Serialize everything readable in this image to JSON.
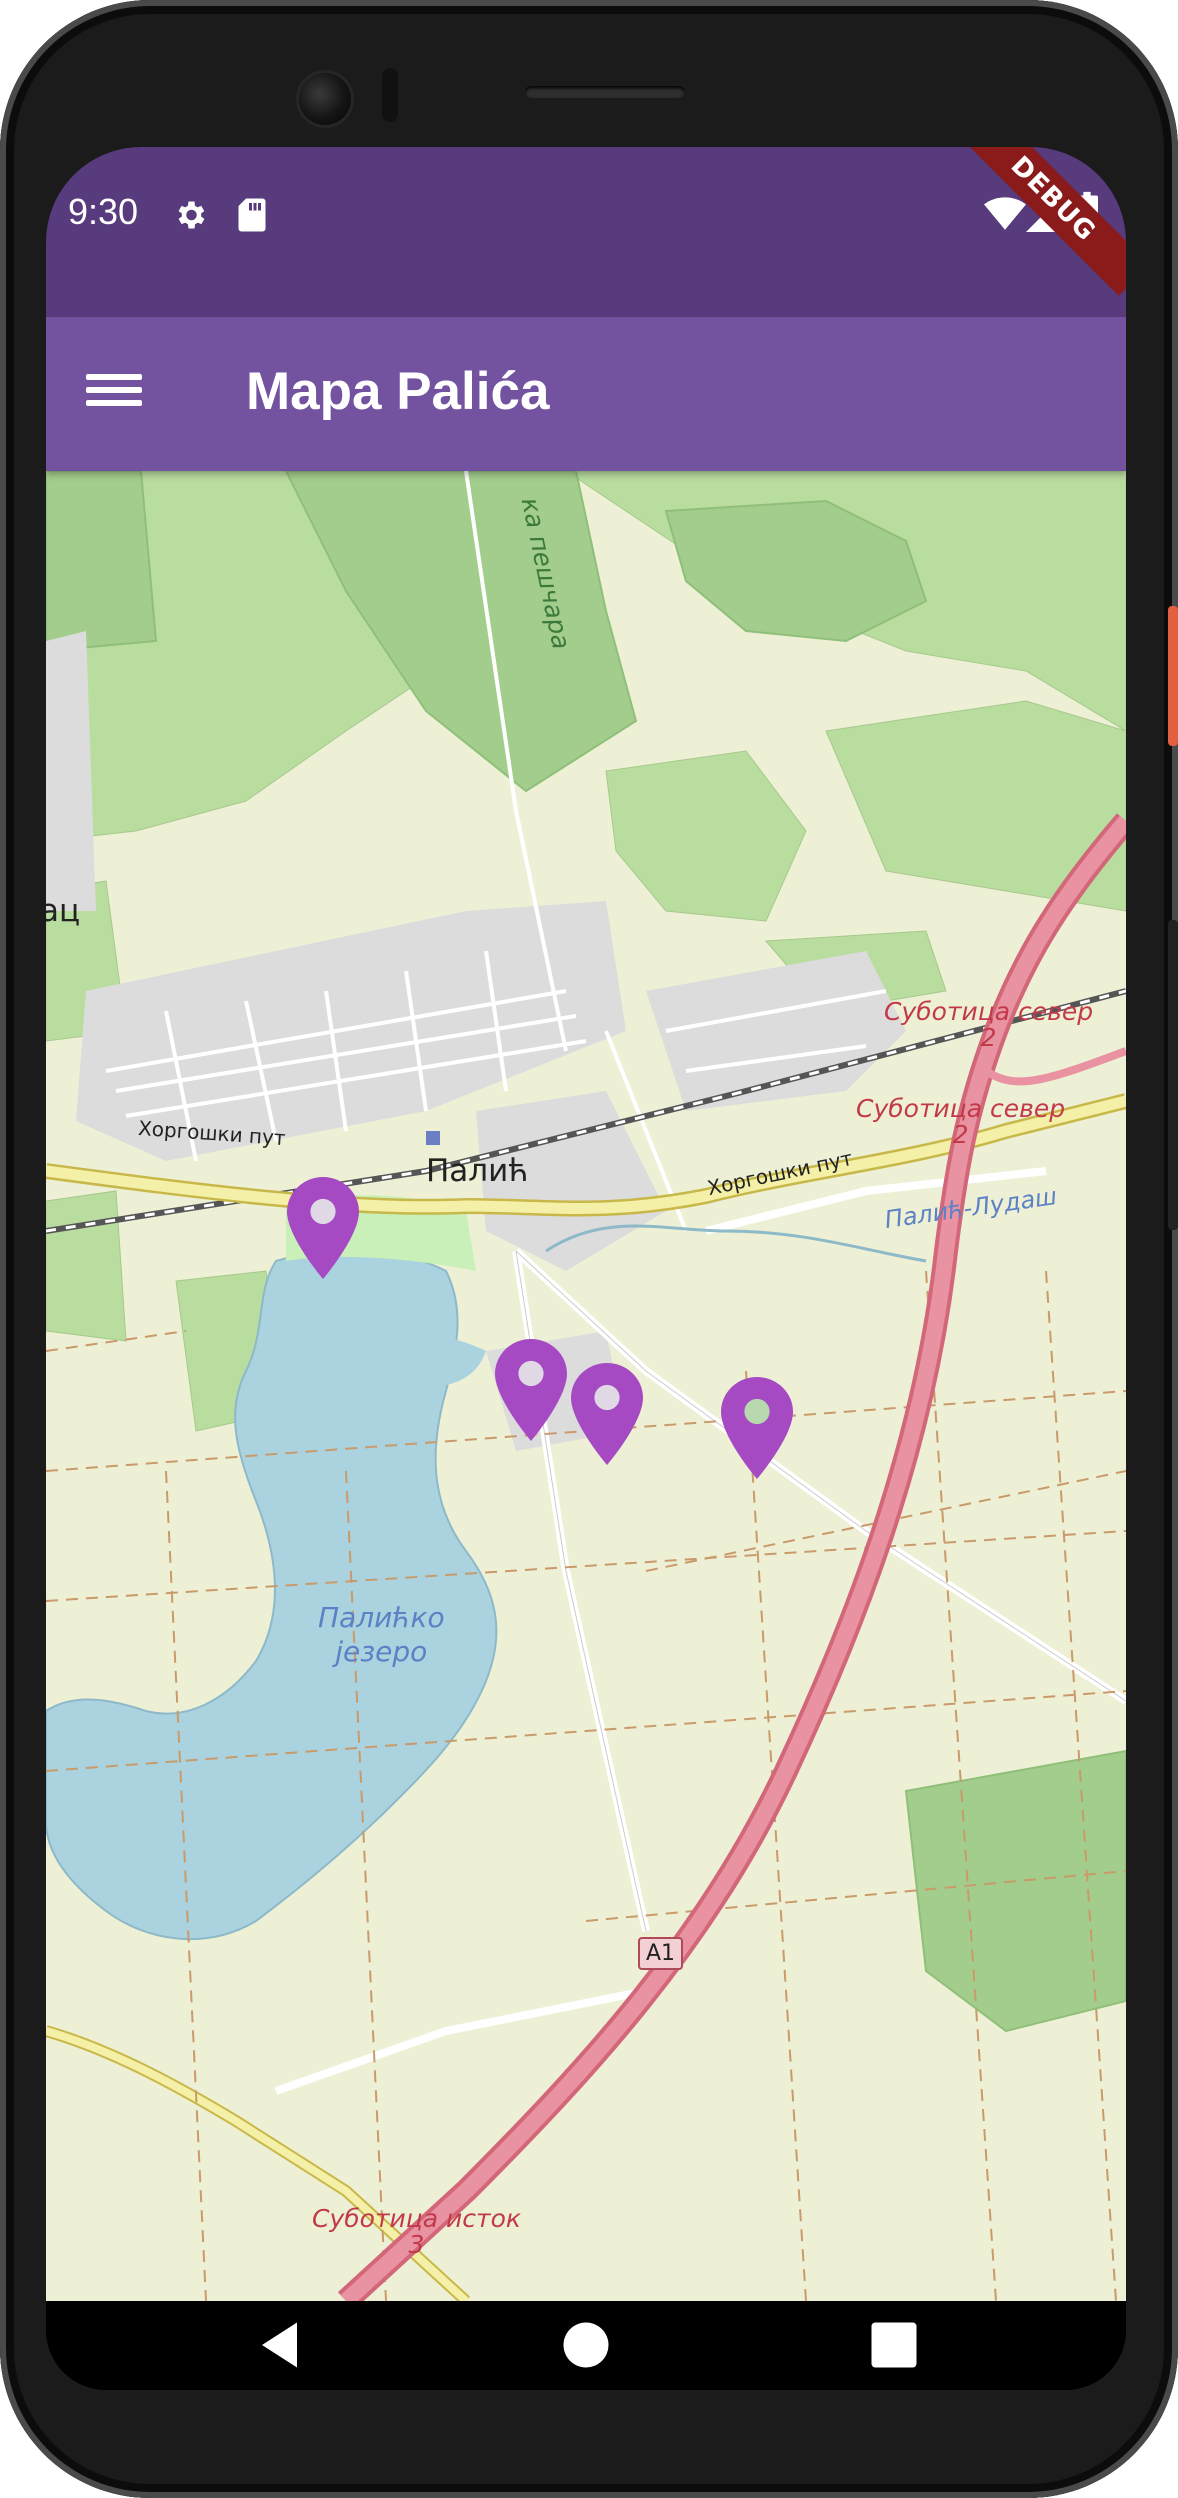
{
  "status_bar": {
    "time": "9:30",
    "left_icons": [
      "gear-icon",
      "sd-card-icon"
    ],
    "right_icons": [
      "wifi-icon",
      "cellular-signal-icon",
      "battery-icon"
    ]
  },
  "debug_banner": "DEBUG",
  "app_bar": {
    "menu_icon": "hamburger-menu-icon",
    "title": "Mapa Palića"
  },
  "map": {
    "labels": {
      "town": "Палић",
      "town_partial": "ац",
      "road_left": "Хоргошки пут",
      "road_right": "Хоргошки пут",
      "forest": "ка пешчара",
      "lake": "Палићко језеро",
      "lake_line1": "Палићко",
      "lake_line2": "језеро",
      "ludas": "Палић-Лудаш",
      "exit_north_1": "Суботица север",
      "exit_north_1_num": "2",
      "exit_north_2": "Суботица север",
      "exit_north_2_num": "2",
      "exit_east": "Суботица исток",
      "exit_east_num": "3",
      "highway_shield": "A1"
    },
    "marker_color": "#a54ac2",
    "markers": [
      "location-pin-icon",
      "location-pin-icon",
      "location-pin-icon",
      "location-pin-icon"
    ]
  },
  "nav_bar": {
    "buttons": [
      "back-icon",
      "home-icon",
      "recents-icon"
    ]
  },
  "colors": {
    "status_bar": "#573b7c",
    "app_bar": "#7353a0",
    "map_background": "#ecefd4",
    "water": "#aad3df",
    "forest": "#a8d29a",
    "motorway": "#e892a2"
  }
}
